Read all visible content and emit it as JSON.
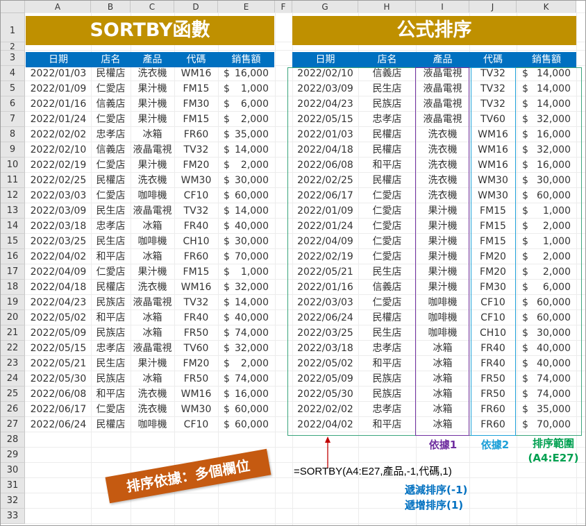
{
  "sheet": {
    "columns": [
      "A",
      "B",
      "C",
      "D",
      "E",
      "F",
      "G",
      "H",
      "I",
      "J",
      "K"
    ],
    "rows": [
      "1",
      "2",
      "3",
      "4",
      "5",
      "6",
      "7",
      "8",
      "9",
      "10",
      "11",
      "12",
      "13",
      "14",
      "15",
      "16",
      "17",
      "18",
      "19",
      "20",
      "21",
      "22",
      "23",
      "24",
      "25",
      "26",
      "27",
      "28",
      "29",
      "30",
      "31",
      "32",
      "33"
    ]
  },
  "left": {
    "title": "SORTBY函數",
    "headers": [
      "日期",
      "店名",
      "產品",
      "代碼",
      "銷售額"
    ],
    "rows": [
      [
        "2022/01/03",
        "民權店",
        "洗衣機",
        "WM16",
        "16,000"
      ],
      [
        "2022/01/09",
        "仁愛店",
        "果汁機",
        "FM15",
        "1,000"
      ],
      [
        "2022/01/16",
        "信義店",
        "果汁機",
        "FM30",
        "6,000"
      ],
      [
        "2022/01/24",
        "仁愛店",
        "果汁機",
        "FM15",
        "2,000"
      ],
      [
        "2022/02/02",
        "忠孝店",
        "冰箱",
        "FR60",
        "35,000"
      ],
      [
        "2022/02/10",
        "信義店",
        "液晶電視",
        "TV32",
        "14,000"
      ],
      [
        "2022/02/19",
        "仁愛店",
        "果汁機",
        "FM20",
        "2,000"
      ],
      [
        "2022/02/25",
        "民權店",
        "洗衣機",
        "WM30",
        "30,000"
      ],
      [
        "2022/03/03",
        "仁愛店",
        "咖啡機",
        "CF10",
        "60,000"
      ],
      [
        "2022/03/09",
        "民生店",
        "液晶電視",
        "TV32",
        "14,000"
      ],
      [
        "2022/03/18",
        "忠孝店",
        "冰箱",
        "FR40",
        "40,000"
      ],
      [
        "2022/03/25",
        "民生店",
        "咖啡機",
        "CH10",
        "30,000"
      ],
      [
        "2022/04/02",
        "和平店",
        "冰箱",
        "FR60",
        "70,000"
      ],
      [
        "2022/04/09",
        "仁愛店",
        "果汁機",
        "FM15",
        "1,000"
      ],
      [
        "2022/04/18",
        "民權店",
        "洗衣機",
        "WM16",
        "32,000"
      ],
      [
        "2022/04/23",
        "民族店",
        "液晶電視",
        "TV32",
        "14,000"
      ],
      [
        "2022/05/02",
        "和平店",
        "冰箱",
        "FR40",
        "40,000"
      ],
      [
        "2022/05/09",
        "民族店",
        "冰箱",
        "FR50",
        "74,000"
      ],
      [
        "2022/05/15",
        "忠孝店",
        "液晶電視",
        "TV60",
        "32,000"
      ],
      [
        "2022/05/21",
        "民生店",
        "果汁機",
        "FM20",
        "2,000"
      ],
      [
        "2022/05/30",
        "民族店",
        "冰箱",
        "FR50",
        "74,000"
      ],
      [
        "2022/06/08",
        "和平店",
        "洗衣機",
        "WM16",
        "16,000"
      ],
      [
        "2022/06/17",
        "仁愛店",
        "洗衣機",
        "WM30",
        "60,000"
      ],
      [
        "2022/06/24",
        "民權店",
        "咖啡機",
        "CF10",
        "60,000"
      ]
    ]
  },
  "right": {
    "title": "公式排序",
    "headers": [
      "日期",
      "店名",
      "產品",
      "代碼",
      "銷售額"
    ],
    "rows": [
      [
        "2022/02/10",
        "信義店",
        "液晶電視",
        "TV32",
        "14,000"
      ],
      [
        "2022/03/09",
        "民生店",
        "液晶電視",
        "TV32",
        "14,000"
      ],
      [
        "2022/04/23",
        "民族店",
        "液晶電視",
        "TV32",
        "14,000"
      ],
      [
        "2022/05/15",
        "忠孝店",
        "液晶電視",
        "TV60",
        "32,000"
      ],
      [
        "2022/01/03",
        "民權店",
        "洗衣機",
        "WM16",
        "16,000"
      ],
      [
        "2022/04/18",
        "民權店",
        "洗衣機",
        "WM16",
        "32,000"
      ],
      [
        "2022/06/08",
        "和平店",
        "洗衣機",
        "WM16",
        "16,000"
      ],
      [
        "2022/02/25",
        "民權店",
        "洗衣機",
        "WM30",
        "30,000"
      ],
      [
        "2022/06/17",
        "仁愛店",
        "洗衣機",
        "WM30",
        "60,000"
      ],
      [
        "2022/01/09",
        "仁愛店",
        "果汁機",
        "FM15",
        "1,000"
      ],
      [
        "2022/01/24",
        "仁愛店",
        "果汁機",
        "FM15",
        "2,000"
      ],
      [
        "2022/04/09",
        "仁愛店",
        "果汁機",
        "FM15",
        "1,000"
      ],
      [
        "2022/02/19",
        "仁愛店",
        "果汁機",
        "FM20",
        "2,000"
      ],
      [
        "2022/05/21",
        "民生店",
        "果汁機",
        "FM20",
        "2,000"
      ],
      [
        "2022/01/16",
        "信義店",
        "果汁機",
        "FM30",
        "6,000"
      ],
      [
        "2022/03/03",
        "仁愛店",
        "咖啡機",
        "CF10",
        "60,000"
      ],
      [
        "2022/06/24",
        "民權店",
        "咖啡機",
        "CF10",
        "60,000"
      ],
      [
        "2022/03/25",
        "民生店",
        "咖啡機",
        "CH10",
        "30,000"
      ],
      [
        "2022/03/18",
        "忠孝店",
        "冰箱",
        "FR40",
        "40,000"
      ],
      [
        "2022/05/02",
        "和平店",
        "冰箱",
        "FR40",
        "40,000"
      ],
      [
        "2022/05/09",
        "民族店",
        "冰箱",
        "FR50",
        "74,000"
      ],
      [
        "2022/05/30",
        "民族店",
        "冰箱",
        "FR50",
        "74,000"
      ],
      [
        "2022/02/02",
        "忠孝店",
        "冰箱",
        "FR60",
        "35,000"
      ],
      [
        "2022/04/02",
        "和平店",
        "冰箱",
        "FR60",
        "70,000"
      ]
    ]
  },
  "currency_symbol": "$",
  "annotations": {
    "basis1": "依據1",
    "basis2": "依據2",
    "range_line1": "排序範圍",
    "range_line2": "(A4:E27)",
    "formula": "=SORTBY(A4:E27,產品,-1,代碼,1)",
    "desc_sort": "遞減排序(-1)",
    "asc_sort": "遞增排序(1)",
    "callout": "排序依據：多個欄位"
  },
  "colors": {
    "banner": "#bf9000",
    "header_fill": "#0070c0",
    "range_box": "#3aa57c",
    "basis1": "#7030a0",
    "basis2": "#1ca0d8",
    "range_label": "#00a050",
    "sort_text": "#0070c0",
    "callout": "#c55a11",
    "arrow": "#c00000"
  }
}
